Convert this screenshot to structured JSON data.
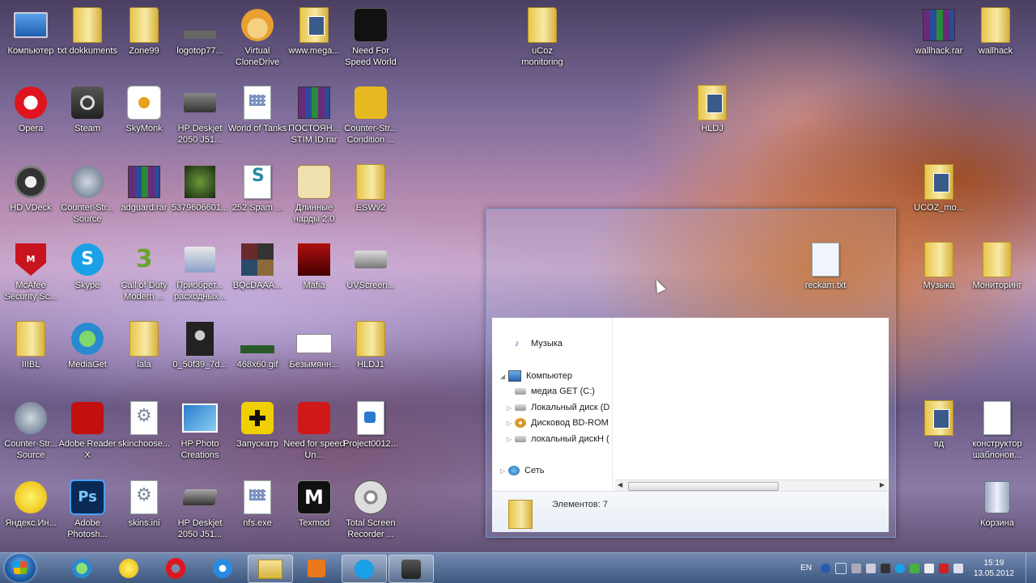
{
  "desktop": {
    "icons": [
      {
        "label": "Компьютер",
        "icon": "computer-icon"
      },
      {
        "label": "txt dokkuments",
        "icon": "folder-icon"
      },
      {
        "label": "Zone99",
        "icon": "folder-icon"
      },
      {
        "label": "logotop77...",
        "icon": "image-icon"
      },
      {
        "label": "Virtual CloneDrive",
        "icon": "sheep-icon"
      },
      {
        "label": "www.mega...",
        "icon": "folder-icon"
      },
      {
        "label": "Need For Speed World",
        "icon": "nfs-icon"
      },
      {
        "label": "uCoz monitoring",
        "icon": "folder-icon"
      },
      {
        "label": "wallhack.rar",
        "icon": "archive-icon"
      },
      {
        "label": "wallhack",
        "icon": "folder-icon"
      },
      {
        "label": "Opera",
        "icon": "opera-icon"
      },
      {
        "label": "Steam",
        "icon": "steam-icon"
      },
      {
        "label": "SkyMonk",
        "icon": "skymonk-icon"
      },
      {
        "label": "HP Deskjet 2050 J51...",
        "icon": "printer-icon"
      },
      {
        "label": "World of Tanks",
        "icon": "document-icon"
      },
      {
        "label": "ПОСТОЯН... STIM ID.rar",
        "icon": "archive-icon"
      },
      {
        "label": "Counter-Str... Condition ...",
        "icon": "cs-icon"
      },
      {
        "label": "HLDJ",
        "icon": "folder-icon"
      },
      {
        "label": "HD VDeck",
        "icon": "hdvdeck-icon"
      },
      {
        "label": "Counter-Str... Source",
        "icon": "cs-icon"
      },
      {
        "label": "adguard.rar",
        "icon": "archive-icon"
      },
      {
        "label": "5379606601...",
        "icon": "image-icon"
      },
      {
        "label": "252 Spam ...",
        "icon": "script-icon"
      },
      {
        "label": "Длинные нарды 2.0",
        "icon": "dice-icon"
      },
      {
        "label": "ESWv2",
        "icon": "folder-icon"
      },
      {
        "label": "UCOZ_mo...",
        "icon": "folder-icon"
      },
      {
        "label": "McAfee Security Sc...",
        "icon": "mcafee-icon"
      },
      {
        "label": "Skype",
        "icon": "skype-icon"
      },
      {
        "label": "Call of Duty Modern ...",
        "icon": "cod-icon"
      },
      {
        "label": "Приобрет... расходных...",
        "icon": "printer-icon"
      },
      {
        "label": "BQcDAAA...",
        "icon": "image-icon"
      },
      {
        "label": "Mafia",
        "icon": "mafia-icon"
      },
      {
        "label": "UVScreen...",
        "icon": "camera-icon"
      },
      {
        "label": "reckam.txt",
        "icon": "text-file-icon"
      },
      {
        "label": "Музыка",
        "icon": "folder-icon"
      },
      {
        "label": "Мониторинг",
        "icon": "folder-icon"
      },
      {
        "label": "IIIBL",
        "icon": "folder-icon"
      },
      {
        "label": "MediaGet",
        "icon": "mediaget-icon"
      },
      {
        "label": "lala",
        "icon": "folder-icon"
      },
      {
        "label": "0_50f39_7d...",
        "icon": "image-icon"
      },
      {
        "label": "468x60.gif",
        "icon": "image-icon"
      },
      {
        "label": "Безымянн...",
        "icon": "image-icon"
      },
      {
        "label": "HLDJ1",
        "icon": "folder-icon"
      },
      {
        "label": "Counter-Str... Source",
        "icon": "cs-icon"
      },
      {
        "label": "Adobe Reader X",
        "icon": "adobe-reader-icon"
      },
      {
        "label": "skinchoose...",
        "icon": "settings-file-icon"
      },
      {
        "label": "HP Photo Creations",
        "icon": "hp-photo-icon"
      },
      {
        "label": "Запускатр",
        "icon": "puzzle-icon"
      },
      {
        "label": "Need for speed Un...",
        "icon": "nfs-icon"
      },
      {
        "label": "Project0012...",
        "icon": "media-file-icon"
      },
      {
        "label": "вд",
        "icon": "folder-icon"
      },
      {
        "label": "конструктор шаблонов...",
        "icon": "document-icon"
      },
      {
        "label": "Яндекс.Ин...",
        "icon": "yandex-icon"
      },
      {
        "label": "Adobe Photosh...",
        "icon": "photoshop-icon"
      },
      {
        "label": "skins.ini",
        "icon": "settings-file-icon"
      },
      {
        "label": "HP Deskjet 2050 J51...",
        "icon": "scanner-icon"
      },
      {
        "label": "nfs.exe",
        "icon": "document-icon"
      },
      {
        "label": "Texmod",
        "icon": "texmod-icon"
      },
      {
        "label": "Total Screen Recorder ...",
        "icon": "film-reel-icon"
      },
      {
        "label": "Корзина",
        "icon": "recycle-bin-icon"
      }
    ]
  },
  "explorer": {
    "nav": [
      {
        "label": "Музыка",
        "icon": "music-library-icon"
      },
      {
        "label": "Компьютер",
        "icon": "computer-icon"
      },
      {
        "label": "медиа GET (C:)",
        "icon": "drive-icon"
      },
      {
        "label": "Локальный диск (D",
        "icon": "drive-icon"
      },
      {
        "label": "Дисковод BD-ROM",
        "icon": "optical-drive-icon"
      },
      {
        "label": "локальный дискН (",
        "icon": "drive-icon"
      },
      {
        "label": "Сеть",
        "icon": "network-icon"
      }
    ],
    "status": "Элементов: 7"
  },
  "taskbar": {
    "apps": [
      "media-get-icon",
      "yandex-icon",
      "opera-icon",
      "internet-explorer-icon",
      "explorer-icon",
      "media-player-icon",
      "skype-icon",
      "steam-icon"
    ],
    "language": "EN",
    "time": "15:19",
    "date": "13.05.2012"
  }
}
